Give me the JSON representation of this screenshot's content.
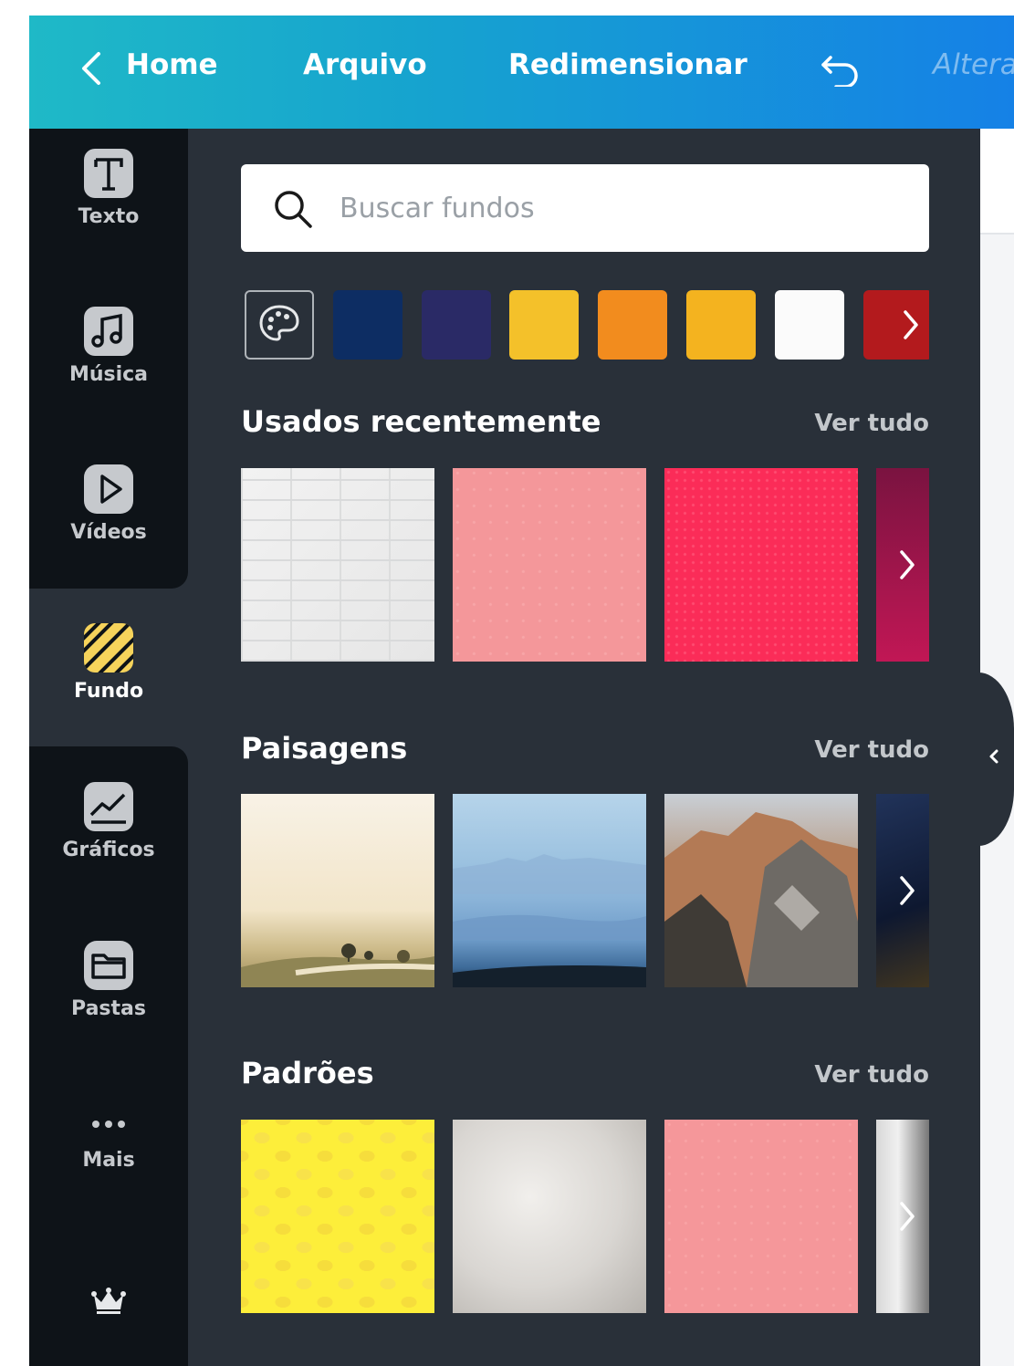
{
  "topbar": {
    "home_label": "Home",
    "file_label": "Arquivo",
    "resize_label": "Redimensionar",
    "faded_label": "Altera",
    "undo_icon": "undo-icon",
    "back_icon": "chevron-left-icon"
  },
  "sidebar": {
    "items": [
      {
        "label": "Texto",
        "icon": "text-icon"
      },
      {
        "label": "Música",
        "icon": "music-icon"
      },
      {
        "label": "Vídeos",
        "icon": "video-icon"
      },
      {
        "label": "Fundo",
        "icon": "background-icon",
        "active": true
      },
      {
        "label": "Gráficos",
        "icon": "chart-icon"
      },
      {
        "label": "Pastas",
        "icon": "folder-icon"
      },
      {
        "label": "Mais",
        "icon": "more-icon"
      }
    ],
    "premium_icon": "crown-icon"
  },
  "search": {
    "placeholder": "Buscar fundos"
  },
  "colors": {
    "swatches": [
      "#0d2d63",
      "#2a2a66",
      "#f4c12a",
      "#f28c1e",
      "#f4b31f",
      "#fbfbfb",
      "#b31a1d"
    ],
    "topbar_gradient_start": "#1fb9c7",
    "topbar_gradient_end": "#1581e6",
    "panel_bg": "#293039",
    "nav_bg": "#0e1318",
    "active_accent": "#f6d35b"
  },
  "sections": {
    "recent": {
      "title": "Usados recentemente",
      "see_all": "Ver tudo"
    },
    "landscapes": {
      "title": "Paisagens",
      "see_all": "Ver tudo"
    },
    "patterns": {
      "title": "Padrões",
      "see_all": "Ver tudo"
    }
  }
}
